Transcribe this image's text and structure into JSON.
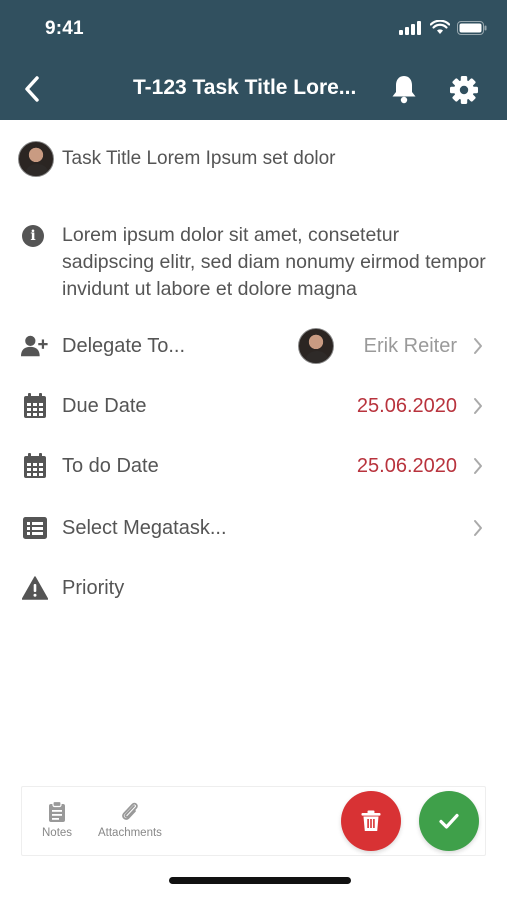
{
  "status_bar": {
    "time": "9:41"
  },
  "nav": {
    "title": "T-123 Task Title Lore..."
  },
  "task": {
    "title": "Task Title Lorem Ipsum set dolor",
    "description": "Lorem ipsum dolor sit amet, consetetur sadipscing elitr, sed diam nonumy eirmod tempor invidunt ut labore et dolore magna"
  },
  "fields": {
    "delegate": {
      "label": "Delegate To...",
      "value": "Erik Reiter"
    },
    "due_date": {
      "label": "Due Date",
      "value": "25.06.2020"
    },
    "todo_date": {
      "label": "To do Date",
      "value": "25.06.2020"
    },
    "megatask": {
      "label": "Select Megatask..."
    },
    "priority": {
      "label": "Priority"
    }
  },
  "bottom_bar": {
    "notes_label": "Notes",
    "attachments_label": "Attachments"
  },
  "colors": {
    "header": "#31505f",
    "date_red": "#b8333d",
    "delete": "#d83234",
    "confirm": "#3fa04a"
  }
}
